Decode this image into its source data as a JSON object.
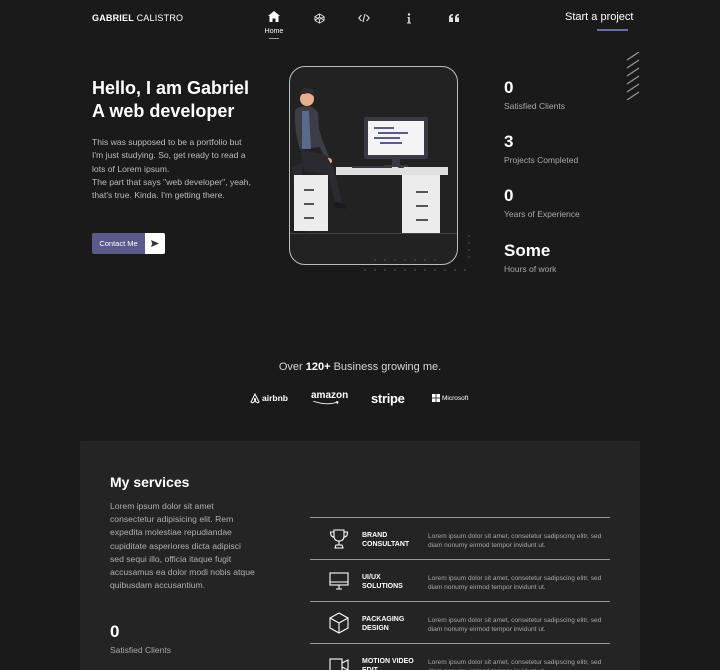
{
  "nav": {
    "brand_bold": "GABRIEL",
    "brand_light": "CALISTRO",
    "home_label": "Home",
    "icons": [
      "home-icon",
      "codepen-icon",
      "code-icon",
      "info-icon",
      "quote-icon"
    ],
    "cta": "Start a project"
  },
  "hero": {
    "title_line1": "Hello, I am Gabriel",
    "title_line2": "A web developer",
    "desc_line1": "This was supposed to be a portfolio but I'm just studying. So, get ready to read a lots of Lorem ipsum.",
    "desc_line2": "The part that says \"web developer\", yeah, that's true. Kinda. I'm getting there.",
    "button_label": "Contact Me"
  },
  "stats": [
    {
      "value": "0",
      "label": "Satisfied Clients"
    },
    {
      "value": "3",
      "label": "Projects Completed"
    },
    {
      "value": "0",
      "label": "Years of Experience"
    },
    {
      "value": "Some",
      "label": "Hours of work"
    }
  ],
  "business": {
    "prefix": "Over",
    "count": "120+",
    "suffix": "Business growing me.",
    "logos": [
      "airbnb",
      "amazon",
      "stripe",
      "Microsoft"
    ]
  },
  "services": {
    "title": "My services",
    "desc": "Lorem ipsum dolor sit amet consectetur adipisicing elit. Rem expedita molestiae repudiandae cupiditate asperiores dicta adipisci sed sequi illo, officia itaque fugit accusamus ea dolor modi nobis atque quibusdam accusantium.",
    "stat_value": "0",
    "stat_label": "Satisfied Clients",
    "items": [
      {
        "name": "BRAND CONSULTANT",
        "text": "Lorem ipsum dolor sit amet, consetetur sadipscing elitr, sed diam nonumy eirmod tempor invidunt ut.",
        "icon": "trophy-icon"
      },
      {
        "name": "UI/UX SOLUTIONS",
        "text": "Lorem ipsum dolor sit amet, consetetur sadipscing elitr, sed diam nonumy eirmod tempor invidunt ut.",
        "icon": "monitor-icon"
      },
      {
        "name": "PACKAGING DESIGN",
        "text": "Lorem ipsum dolor sit amet, consetetur sadipscing elitr, sed diam nonumy eirmod tempor invidunt ut.",
        "icon": "box-icon"
      },
      {
        "name": "MOTION VIDEO EDIT",
        "text": "Lorem ipsum dolor sit amet, consetetur sadipscing elitr, sed diam nonumy eirmod tempor invidunt ut.",
        "icon": "video-icon"
      }
    ]
  },
  "colors": {
    "background": "#1a1a1a",
    "panel": "#242424",
    "accent": "#5a5b8c"
  }
}
